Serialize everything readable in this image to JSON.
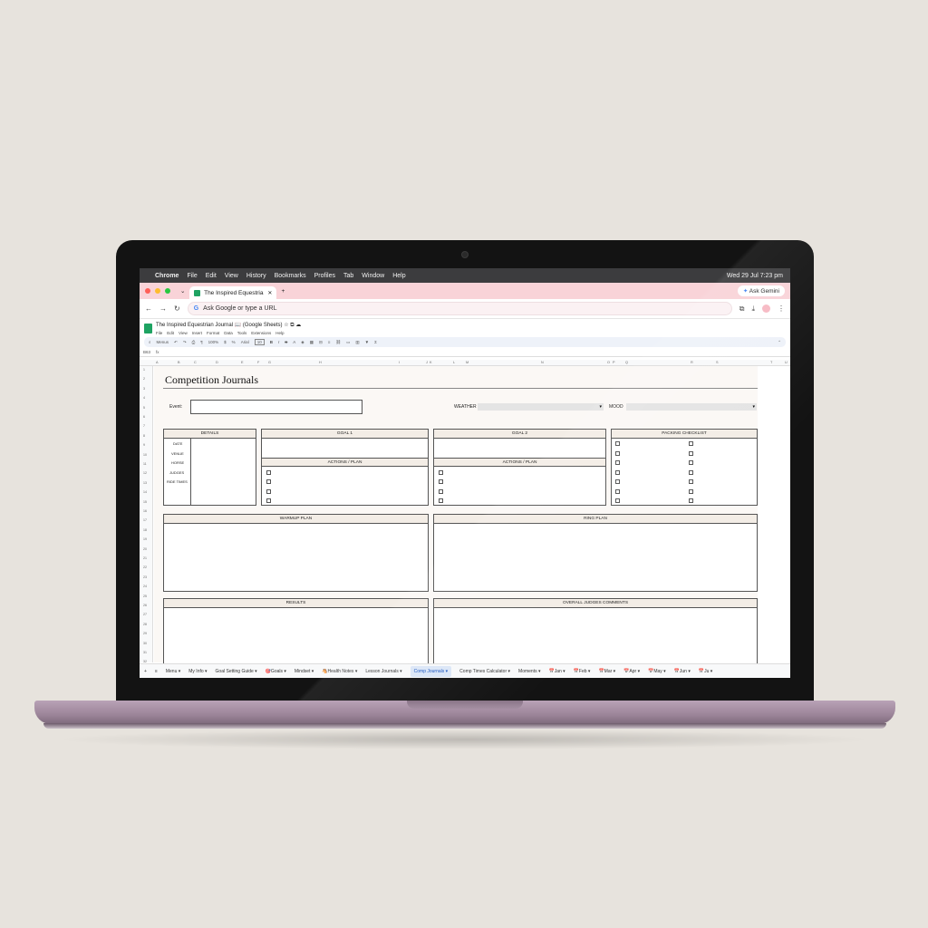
{
  "menubar": {
    "app": "Chrome",
    "items": [
      "File",
      "Edit",
      "View",
      "History",
      "Bookmarks",
      "Profiles",
      "Tab",
      "Window",
      "Help"
    ],
    "clock": "Wed 29 Jul  7:23 pm"
  },
  "browser": {
    "tab_title": "The Inspired Equestrian Journal",
    "gemini": "Ask Gemini",
    "omnibox_placeholder": "Ask Google or type a URL"
  },
  "sheets": {
    "doc_title": "The Inspired Equestrian Journal 📖 (Google Sheets)",
    "menus": [
      "File",
      "Edit",
      "View",
      "Insert",
      "Format",
      "Data",
      "Tools",
      "Extensions",
      "Help"
    ],
    "toolbar": {
      "menus": "Menus",
      "zoom": "100%",
      "font": "Arial",
      "font_size": "10"
    },
    "cell_ref": "B63",
    "columns": [
      "A",
      "B",
      "C",
      "D",
      "E",
      "F",
      "G",
      "H",
      "I",
      "J",
      "K",
      "L",
      "M",
      "N",
      "O",
      "P",
      "Q",
      "R",
      "S",
      "T",
      "U"
    ],
    "rows": [
      "1",
      "2",
      "3",
      "4",
      "5",
      "6",
      "7",
      "8",
      "9",
      "10",
      "11",
      "12",
      "13",
      "14",
      "15",
      "16",
      "17",
      "18",
      "19",
      "20",
      "21",
      "22",
      "23",
      "24",
      "25",
      "26",
      "27",
      "28",
      "29",
      "30",
      "31",
      "32",
      "33"
    ]
  },
  "journal": {
    "title": "Competition Journals",
    "event_label": "Event:",
    "weather_label": "WEATHER",
    "mood_label": "MOOD",
    "details_header": "DETAILS",
    "detail_rows": [
      "DATE",
      "VENUE",
      "HORSE",
      "JUDGES",
      "RIDE TIMES"
    ],
    "goal1_header": "GOAL 1",
    "goal2_header": "GOAL 2",
    "actions_header": "ACTIONS / PLAN",
    "packing_header": "PACKING CHECKLIST",
    "warmup_header": "WARMUP PLAN",
    "ring_header": "RING PLAN",
    "results_header": "RESULTS",
    "judges_header": "OVERALL JUDGES COMMENTS"
  },
  "sheet_tabs": [
    "Menu",
    "My Info",
    "Goal Setting Guide",
    "🎯Goals",
    "Mindset",
    "🐴Health Notes",
    "Lesson Journals",
    "Comp Journals",
    "Comp Times Calculator",
    "Moments",
    "📅Jan",
    "📅Feb",
    "📅Mar",
    "📅Apr",
    "📅May",
    "📅Jun",
    "📅Ju"
  ],
  "active_tab": "Comp Journals"
}
